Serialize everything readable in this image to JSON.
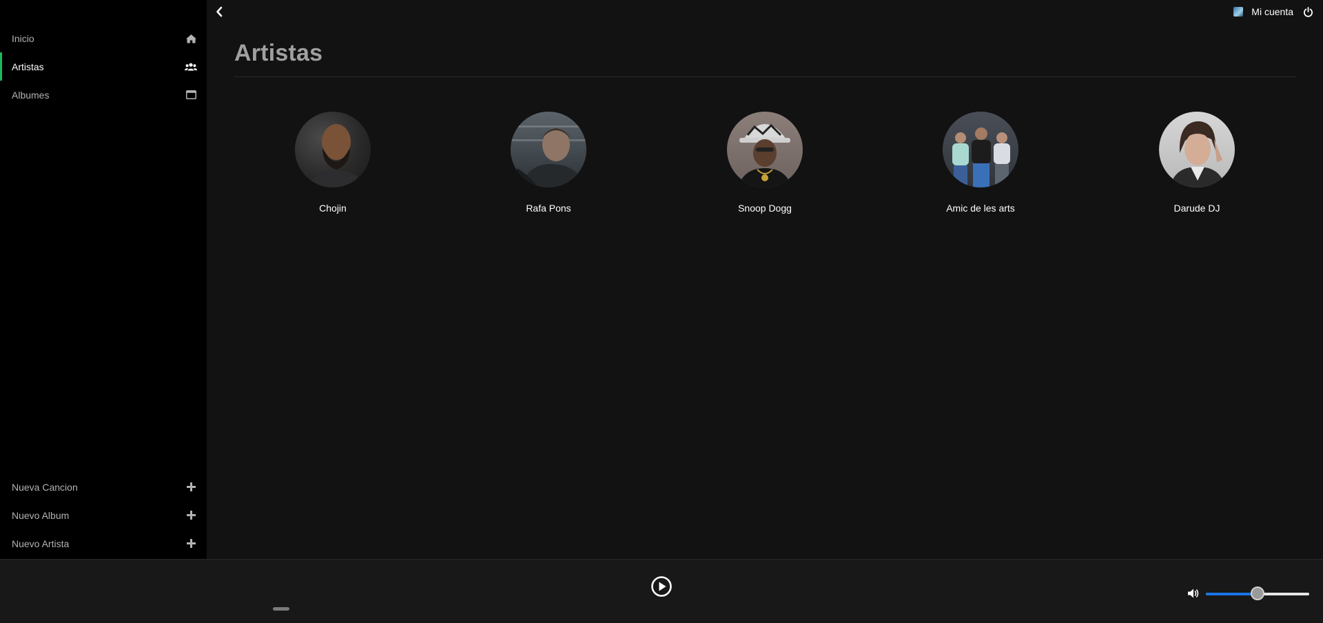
{
  "sidebar": {
    "top_items": [
      {
        "label": "Inicio",
        "icon": "home-icon",
        "active": false
      },
      {
        "label": "Artistas",
        "icon": "users-icon",
        "active": true
      },
      {
        "label": "Albumes",
        "icon": "window-icon",
        "active": false
      }
    ],
    "bottom_items": [
      {
        "label": "Nueva Cancion",
        "icon": "plus-icon"
      },
      {
        "label": "Nuevo Album",
        "icon": "plus-icon"
      },
      {
        "label": "Nuevo Artista",
        "icon": "plus-icon"
      }
    ],
    "accent_color": "#1db954"
  },
  "header": {
    "account_label": "Mi cuenta"
  },
  "main": {
    "title": "Artistas",
    "artists": [
      {
        "name": "Chojin"
      },
      {
        "name": "Rafa Pons"
      },
      {
        "name": "Snoop Dogg"
      },
      {
        "name": "Amic de les arts"
      },
      {
        "name": "Darude DJ"
      }
    ]
  },
  "player": {
    "volume_level": 0.5,
    "volume_color": "#1a73e8"
  }
}
